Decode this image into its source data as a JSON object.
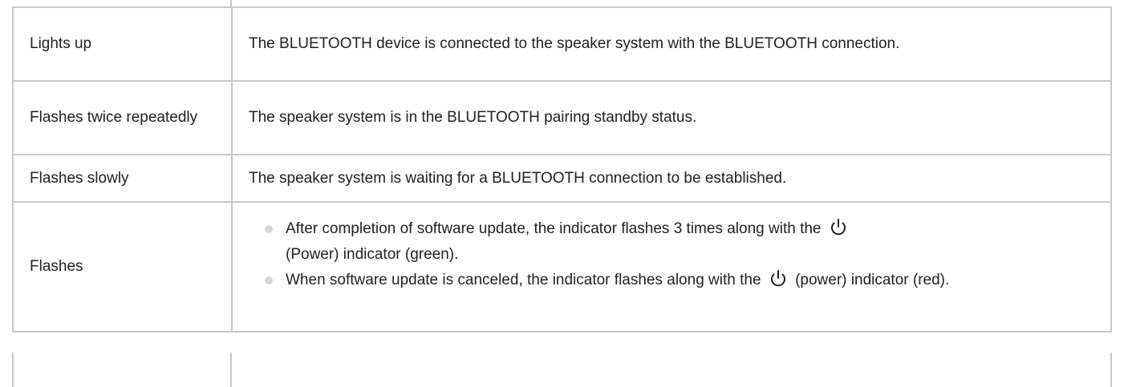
{
  "rows": [
    {
      "state": "Lights up",
      "description": "The BLUETOOTH device is connected to the speaker system with the BLUETOOTH connection."
    },
    {
      "state": "Flashes twice repeatedly",
      "description": "The speaker system is in the BLUETOOTH pairing standby status."
    },
    {
      "state": "Flashes slowly",
      "description": "The speaker system is waiting for a BLUETOOTH connection to be established."
    },
    {
      "state": "Flashes",
      "bullets": [
        {
          "before_icon": "After completion of software update, the indicator flashes 3 times along with the",
          "icon": "power-icon",
          "after_icon": "(Power) indicator (green)."
        },
        {
          "before_icon": "When software update is canceled, the indicator flashes along with the",
          "icon": "power-icon",
          "after_icon": "(power) indicator (red)."
        }
      ]
    }
  ],
  "colors": {
    "border": "#c8c8c8",
    "text": "#222222",
    "bullet": "#d5d5d5"
  }
}
